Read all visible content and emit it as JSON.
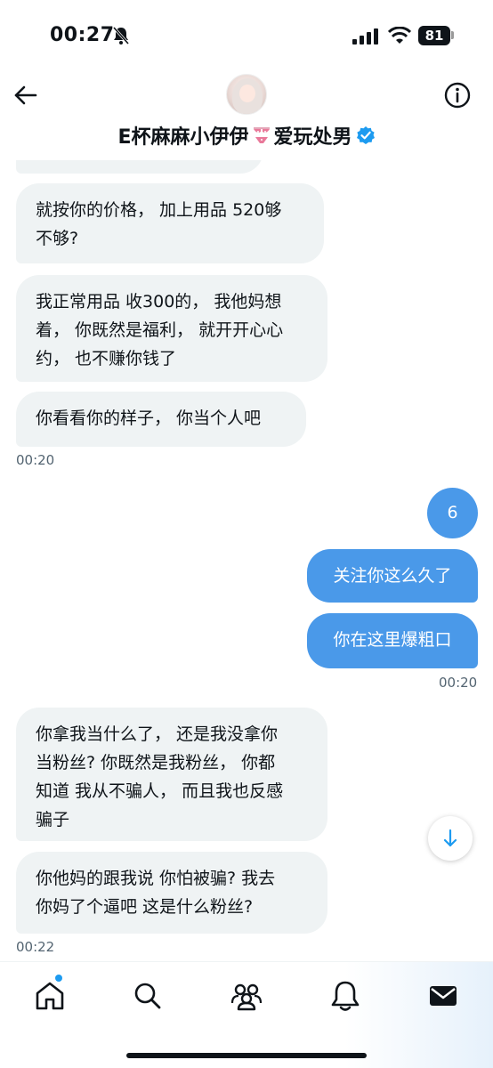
{
  "status_bar": {
    "time": "00:27",
    "battery": "81"
  },
  "header": {
    "contact_name": "E杯麻麻小伊伊",
    "contact_suffix": "爱玩处男"
  },
  "messages": [
    {
      "text": "就按你的价格， 加上用品 520够\n不够?"
    },
    {
      "text": "我正常用品 收300的， 我他妈想\n着， 你既然是福利， 就开开心心\n约， 也不赚你钱了"
    },
    {
      "text": "你看看你的样子， 你当个人吧"
    },
    {
      "time": "00:20"
    },
    {
      "text": "6"
    },
    {
      "text": "关注你这么久了"
    },
    {
      "text": "你在这里爆粗口"
    },
    {
      "time": "00:20"
    },
    {
      "text": "你拿我当什么了， 还是我没拿你\n当粉丝? 你既然是我粉丝， 你都\n知道 我从不骗人， 而且我也反感\n骗子"
    },
    {
      "text": "你他妈的跟我说 你怕被骗? 我去\n你妈了个逼吧 这是什么粉丝?"
    },
    {
      "time": "00:22"
    }
  ],
  "icons": {
    "back": "arrow-left-icon",
    "info": "info-icon",
    "verified": "verified-badge-icon",
    "bikini": "bikini-emoji-icon",
    "scroll_down": "arrow-down-icon",
    "tabs": [
      "home-icon",
      "search-icon",
      "communities-icon",
      "notifications-icon",
      "messages-icon"
    ]
  },
  "colors": {
    "accent": "#1d9bf0",
    "outgoing_bubble": "#4a99e9",
    "incoming_bubble": "#eff3f4",
    "timestamp": "#536471"
  }
}
